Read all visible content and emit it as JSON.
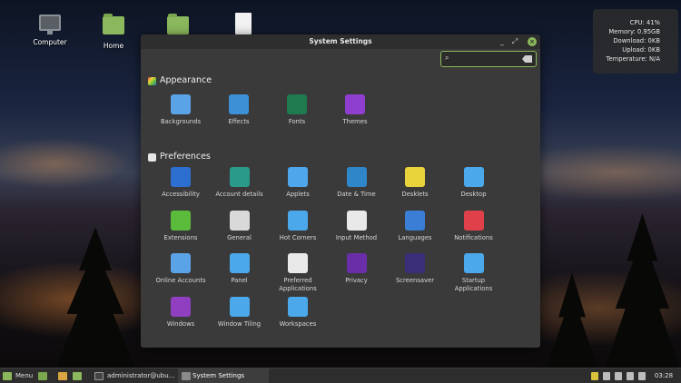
{
  "desktop": {
    "icons": [
      {
        "label": "Computer"
      },
      {
        "label": "Home"
      },
      {
        "label": ""
      },
      {
        "label": ""
      }
    ]
  },
  "conky": {
    "cpu": "CPU: 41%",
    "memory": "Memory: 0.95GB",
    "download": "Download: 0KB",
    "upload": "Upload: 0KB",
    "temperature": "Temperature: N/A"
  },
  "window": {
    "title": "System Settings",
    "search": {
      "value": "",
      "placeholder": ""
    },
    "sections": [
      {
        "title": "Appearance",
        "items": [
          {
            "label": "Backgrounds",
            "icon": "backgrounds-icon",
            "color": "#5aa3e6"
          },
          {
            "label": "Effects",
            "icon": "effects-icon",
            "color": "#3d8fd6"
          },
          {
            "label": "Fonts",
            "icon": "fonts-icon",
            "color": "#1f7a4f"
          },
          {
            "label": "Themes",
            "icon": "themes-icon",
            "color": "#8f3fcf"
          }
        ]
      },
      {
        "title": "Preferences",
        "items": [
          {
            "label": "Accessibility",
            "icon": "accessibility-icon",
            "color": "#2d6fd0"
          },
          {
            "label": "Account details",
            "icon": "account-icon",
            "color": "#2a9a8a"
          },
          {
            "label": "Applets",
            "icon": "applets-icon",
            "color": "#4fa6ea"
          },
          {
            "label": "Date & Time",
            "icon": "clock-icon",
            "color": "#2f86c9"
          },
          {
            "label": "Desklets",
            "icon": "desklets-icon",
            "color": "#e8d33a"
          },
          {
            "label": "Desktop",
            "icon": "desktop-icon",
            "color": "#4ba8ea"
          },
          {
            "label": "Extensions",
            "icon": "puzzle-icon",
            "color": "#5bbb3a"
          },
          {
            "label": "General",
            "icon": "toggles-icon",
            "color": "#d9d9d9"
          },
          {
            "label": "Hot Corners",
            "icon": "hot-corners-icon",
            "color": "#4ba8ea"
          },
          {
            "label": "Input Method",
            "icon": "keyboard-icon",
            "color": "#e9e9e9"
          },
          {
            "label": "Languages",
            "icon": "globe-icon",
            "color": "#3a7ed6"
          },
          {
            "label": "Notifications",
            "icon": "bell-icon",
            "color": "#e0404a"
          },
          {
            "label": "Online Accounts",
            "icon": "cloud-icon",
            "color": "#5aa3e6"
          },
          {
            "label": "Panel",
            "icon": "panel-icon",
            "color": "#4ba8ea"
          },
          {
            "label": "Preferred\nApplications",
            "icon": "music-icon",
            "color": "#e9e9e9"
          },
          {
            "label": "Privacy",
            "icon": "mask-icon",
            "color": "#6a2fa8"
          },
          {
            "label": "Screensaver",
            "icon": "moon-icon",
            "color": "#3b2f7a"
          },
          {
            "label": "Startup\nApplications",
            "icon": "startup-icon",
            "color": "#4ba8ea"
          },
          {
            "label": "Windows",
            "icon": "windows-icon",
            "color": "#8f3fbf"
          },
          {
            "label": "Window Tiling",
            "icon": "tiling-icon",
            "color": "#4ba8ea"
          },
          {
            "label": "Workspaces",
            "icon": "workspaces-icon",
            "color": "#4ba8ea"
          }
        ]
      }
    ]
  },
  "taskbar": {
    "menu_label": "Menu",
    "tasks": [
      {
        "label": "administrator@ubu..."
      },
      {
        "label": "System Settings"
      }
    ],
    "clock": "03:28"
  }
}
